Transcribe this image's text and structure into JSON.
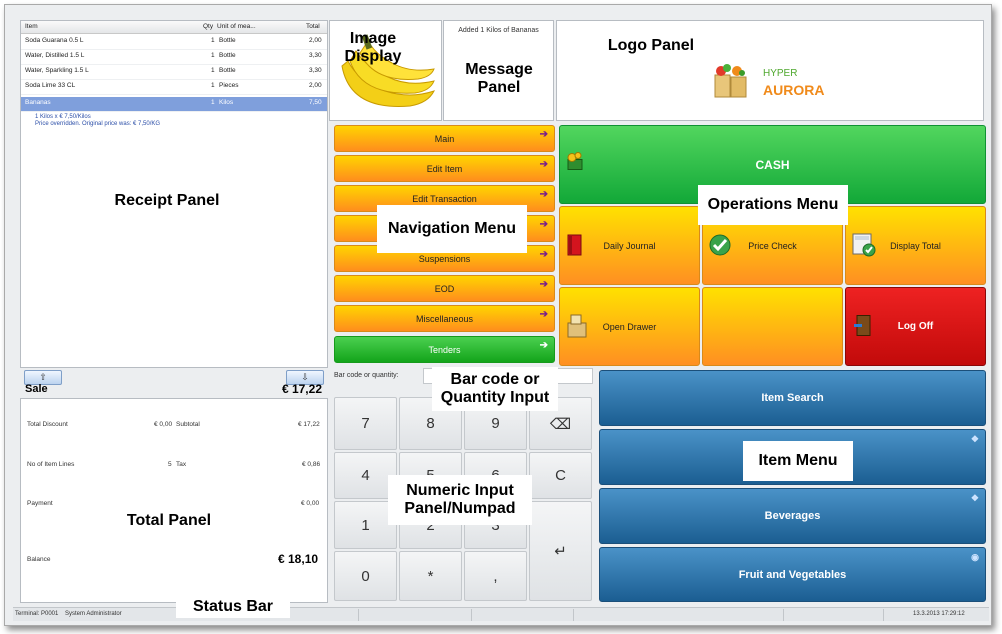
{
  "receipt": {
    "headers": [
      "Item",
      "Qty",
      "Unit of mea...",
      "Total"
    ],
    "rows": [
      {
        "item": "Soda Guarana 0.5 L",
        "qty": "1",
        "unit": "Bottle",
        "total": "2,00"
      },
      {
        "item": "Water, Distilled 1.5 L",
        "qty": "1",
        "unit": "Bottle",
        "total": "3,30"
      },
      {
        "item": "Water, Sparkling 1.5 L",
        "qty": "1",
        "unit": "Bottle",
        "total": "3,30"
      },
      {
        "item": "Soda Lime 33 CL",
        "qty": "1",
        "unit": "Pieces",
        "total": "2,00"
      },
      {
        "item": "Bananas",
        "qty": "1",
        "unit": "Kilos",
        "total": "7,50"
      }
    ],
    "sub_line1": "1 Kilos x € 7,50/Kilos",
    "sub_line2": "Price overridden.  Original price was: € 7,50/KG",
    "sale_label": "Sale",
    "sale_total": "€ 17,22",
    "up_icon": "⇧",
    "down_icon": "⇩"
  },
  "totals": {
    "total_discount_label": "Total Discount",
    "total_discount": "€ 0,00",
    "subtotal_label": "Subtotal",
    "subtotal": "€ 17,22",
    "lines_label": "No of Item Lines",
    "lines": "5",
    "tax_label": "Tax",
    "tax": "€ 0,86",
    "payment_label": "Payment",
    "payment": "€ 0,00",
    "balance_label": "Balance",
    "balance": "€ 18,10"
  },
  "message": {
    "text": "Added 1 Kilos of Bananas"
  },
  "logo": {
    "line1": "HYPER",
    "line2": "AURORA"
  },
  "navigation": [
    "Main",
    "Edit Item",
    "Edit Transaction",
    "",
    "Suspensions",
    "EOD",
    "Miscellaneous",
    "Tenders"
  ],
  "operations": {
    "cash": "CASH",
    "daily_journal": "Daily Journal",
    "price_check": "Price Check",
    "display_total": "Display Total",
    "open_drawer": "Open Drawer",
    "log_off": "Log Off"
  },
  "barcode": {
    "label": "Bar code or quantity:"
  },
  "numpad": {
    "k7": "7",
    "k8": "8",
    "k9": "9",
    "kback": "⌫",
    "k4": "4",
    "k5": "5",
    "k6": "6",
    "kc": "C",
    "k1": "1",
    "k2": "2",
    "k3": "3",
    "kenter": "↵",
    "k0": "0",
    "kstar": "*",
    "kcomma": ","
  },
  "items": {
    "search": "Item Search",
    "menu": "",
    "beverages": "Beverages",
    "fruit": "Fruit and Vegetables"
  },
  "status": {
    "terminal": "Terminal: P0001",
    "user": "System Administrator",
    "datetime": "13.3.2013 17:29:12"
  },
  "callouts": {
    "image": "Image Display",
    "message": "Message Panel",
    "logo": "Logo Panel",
    "receipt": "Receipt Panel",
    "navigation": "Navigation Menu",
    "operations": "Operations Menu",
    "barcode": "Bar code or Quantity Input",
    "item": "Item Menu",
    "numeric": "Numeric Input Panel/Numpad",
    "total": "Total Panel",
    "status": "Status Bar"
  },
  "colors": {
    "nav_orange": "#ff9a1d",
    "nav_green": "#13a41a",
    "cash_green": "#19b640",
    "logoff_red": "#d30f0f",
    "item_blue": "#1b5e92"
  }
}
